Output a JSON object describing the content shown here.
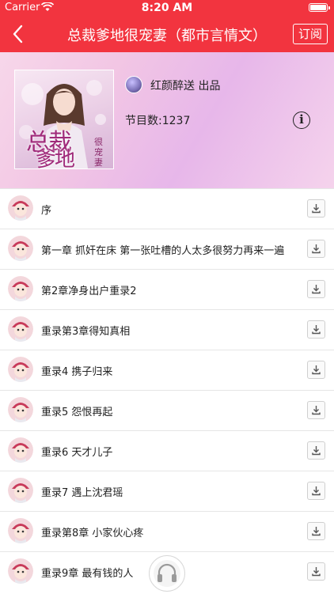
{
  "status_bar": {
    "carrier": "Carrier",
    "time": "8:20 AM"
  },
  "navbar": {
    "title": "总裁爹地很宠妻（都市言情文）",
    "subscribe_label": "订阅"
  },
  "header": {
    "cover_title_big": "总裁",
    "cover_title_second": "爹地",
    "cover_subtitle": "很宠妻",
    "author": "红颜醉送 出品",
    "episode_count": "节目数:1237"
  },
  "episodes": [
    {
      "title": "序"
    },
    {
      "title": "第一章 抓奸在床 第一张吐槽的人太多很努力再来一遍"
    },
    {
      "title": "第2章净身出户重录2"
    },
    {
      "title": "重录第3章得知真相"
    },
    {
      "title": "重录4 携子归来"
    },
    {
      "title": "重录5 怨恨再起"
    },
    {
      "title": "重录6 天才儿子"
    },
    {
      "title": "重录7 遇上沈君瑶"
    },
    {
      "title": "重录第8章 小家伙心疼"
    },
    {
      "title": "重录9章 最有钱的人"
    }
  ],
  "colors": {
    "accent": "#f2343f",
    "header_gradient": "#f2c6e4"
  },
  "icons": {
    "back": "chevron-left-icon",
    "info": "info-circle-icon",
    "download": "download-icon",
    "player": "headphones-icon"
  }
}
